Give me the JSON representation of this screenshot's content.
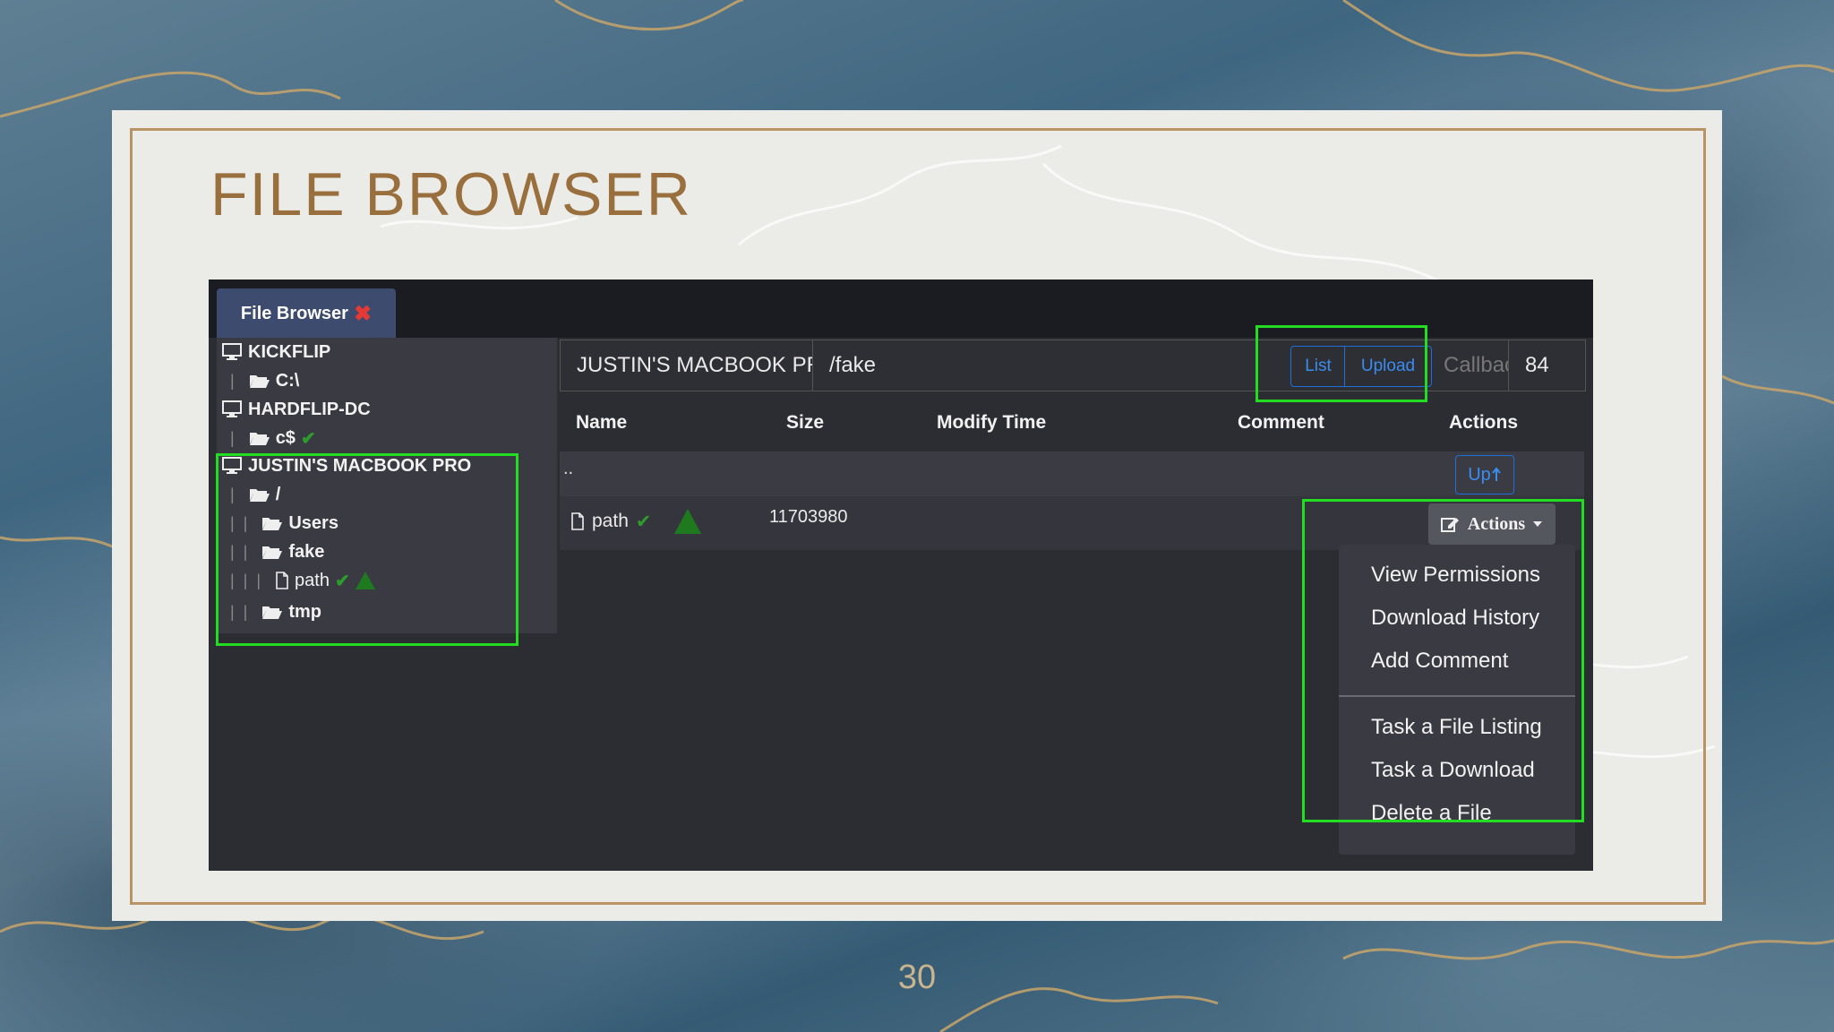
{
  "slide": {
    "title": "FILE BROWSER",
    "page_number": "30"
  },
  "tab": {
    "label": "File Browser",
    "close_icon": "✖"
  },
  "tree": {
    "nodes": [
      {
        "label": "KICKFLIP",
        "icon": "computer-icon"
      },
      {
        "label": "C:\\",
        "icon": "folder-open-icon"
      },
      {
        "label": "HARDFLIP-DC",
        "icon": "computer-icon"
      },
      {
        "label": "c$",
        "icon": "folder-open-icon",
        "status": "✔"
      },
      {
        "label": "JUSTIN'S MACBOOK PRO",
        "icon": "computer-icon"
      },
      {
        "label": "/",
        "icon": "folder-open-icon"
      },
      {
        "label": "Users",
        "icon": "folder-open-icon"
      },
      {
        "label": "fake",
        "icon": "folder-open-icon"
      },
      {
        "label": "path",
        "icon": "file-icon",
        "status": "✔"
      },
      {
        "label": "tmp",
        "icon": "folder-open-icon"
      }
    ]
  },
  "pathbar": {
    "host": "JUSTIN'S MACBOOK PRO",
    "path": "/fake",
    "list_label": "List",
    "upload_label": "Upload",
    "callback_placeholder": "Callback",
    "callback_value": "84"
  },
  "table": {
    "headers": [
      "Name",
      "Size",
      "Modify Time",
      "Comment",
      "Actions"
    ],
    "parent_row": {
      "name": "..",
      "up_label": "Up"
    },
    "rows": [
      {
        "name": "path",
        "status": "✔",
        "size": "11703980",
        "modify_time": "",
        "comment": ""
      }
    ],
    "actions_label": "Actions"
  },
  "actions_menu": {
    "items": [
      "View Permissions",
      "Download History",
      "Add Comment",
      "Task a File Listing",
      "Task a Download",
      "Delete a File"
    ]
  },
  "colors": {
    "highlight": "#22dd22",
    "accent_blue": "#1e6fd9",
    "title_gold": "#9a6f3e",
    "success_green": "#2e9b2e"
  }
}
